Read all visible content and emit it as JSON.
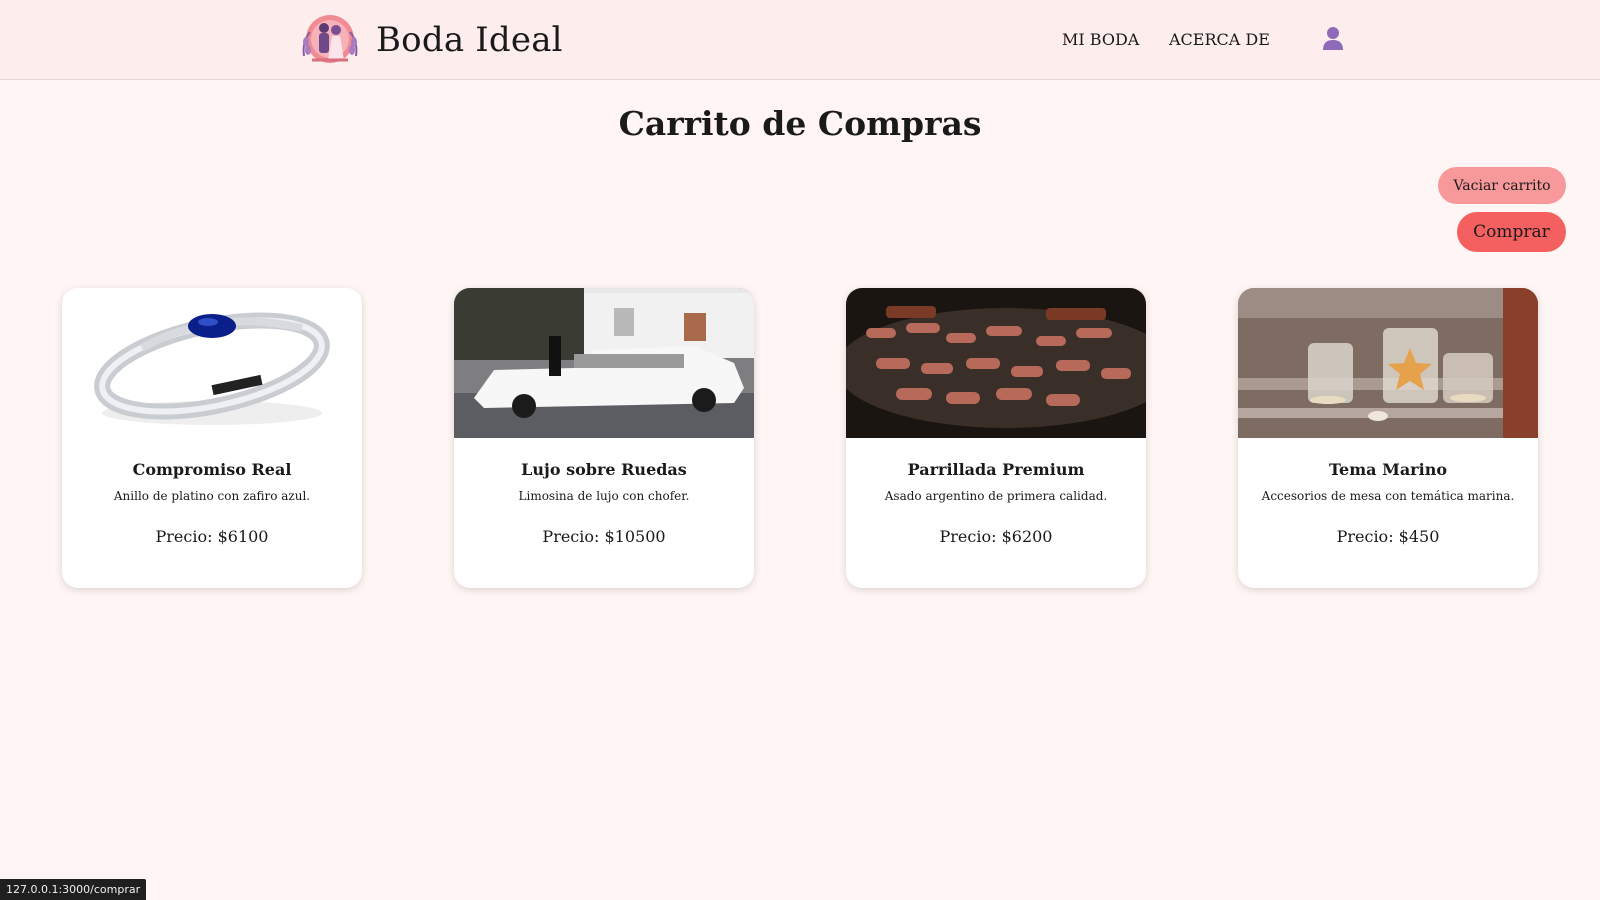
{
  "header": {
    "brand_title": "Boda Ideal",
    "nav": {
      "mi_boda": "MI BODA",
      "acerca_de": "ACERCA DE"
    },
    "icons": {
      "logo": "wedding-couple-logo",
      "user": "user-icon"
    }
  },
  "page": {
    "title": "Carrito de Compras"
  },
  "actions": {
    "vaciar_label": "Vaciar carrito",
    "comprar_label": "Comprar"
  },
  "cart_items": [
    {
      "name": "Compromiso Real",
      "description": "Anillo de platino con zafiro azul.",
      "price": "Precio: $6100",
      "image": "sapphire-ring"
    },
    {
      "name": "Lujo sobre Ruedas",
      "description": "Limosina de lujo con chofer.",
      "price": "Precio: $10500",
      "image": "white-limousine"
    },
    {
      "name": "Parrillada Premium",
      "description": "Asado argentino de primera calidad.",
      "price": "Precio: $6200",
      "image": "grill-barbecue"
    },
    {
      "name": "Tema Marino",
      "description": "Accesorios de mesa con temática marina.",
      "price": "Precio: $450",
      "image": "marine-jars"
    }
  ],
  "status_bar": {
    "url": "127.0.0.1:3000/comprar"
  },
  "colors": {
    "page_background": "#fff5f4",
    "header_background": "#fdeeed",
    "vaciar_button": "#f7999a",
    "comprar_button": "#f45f5f",
    "user_icon": "#8e6ab8"
  }
}
